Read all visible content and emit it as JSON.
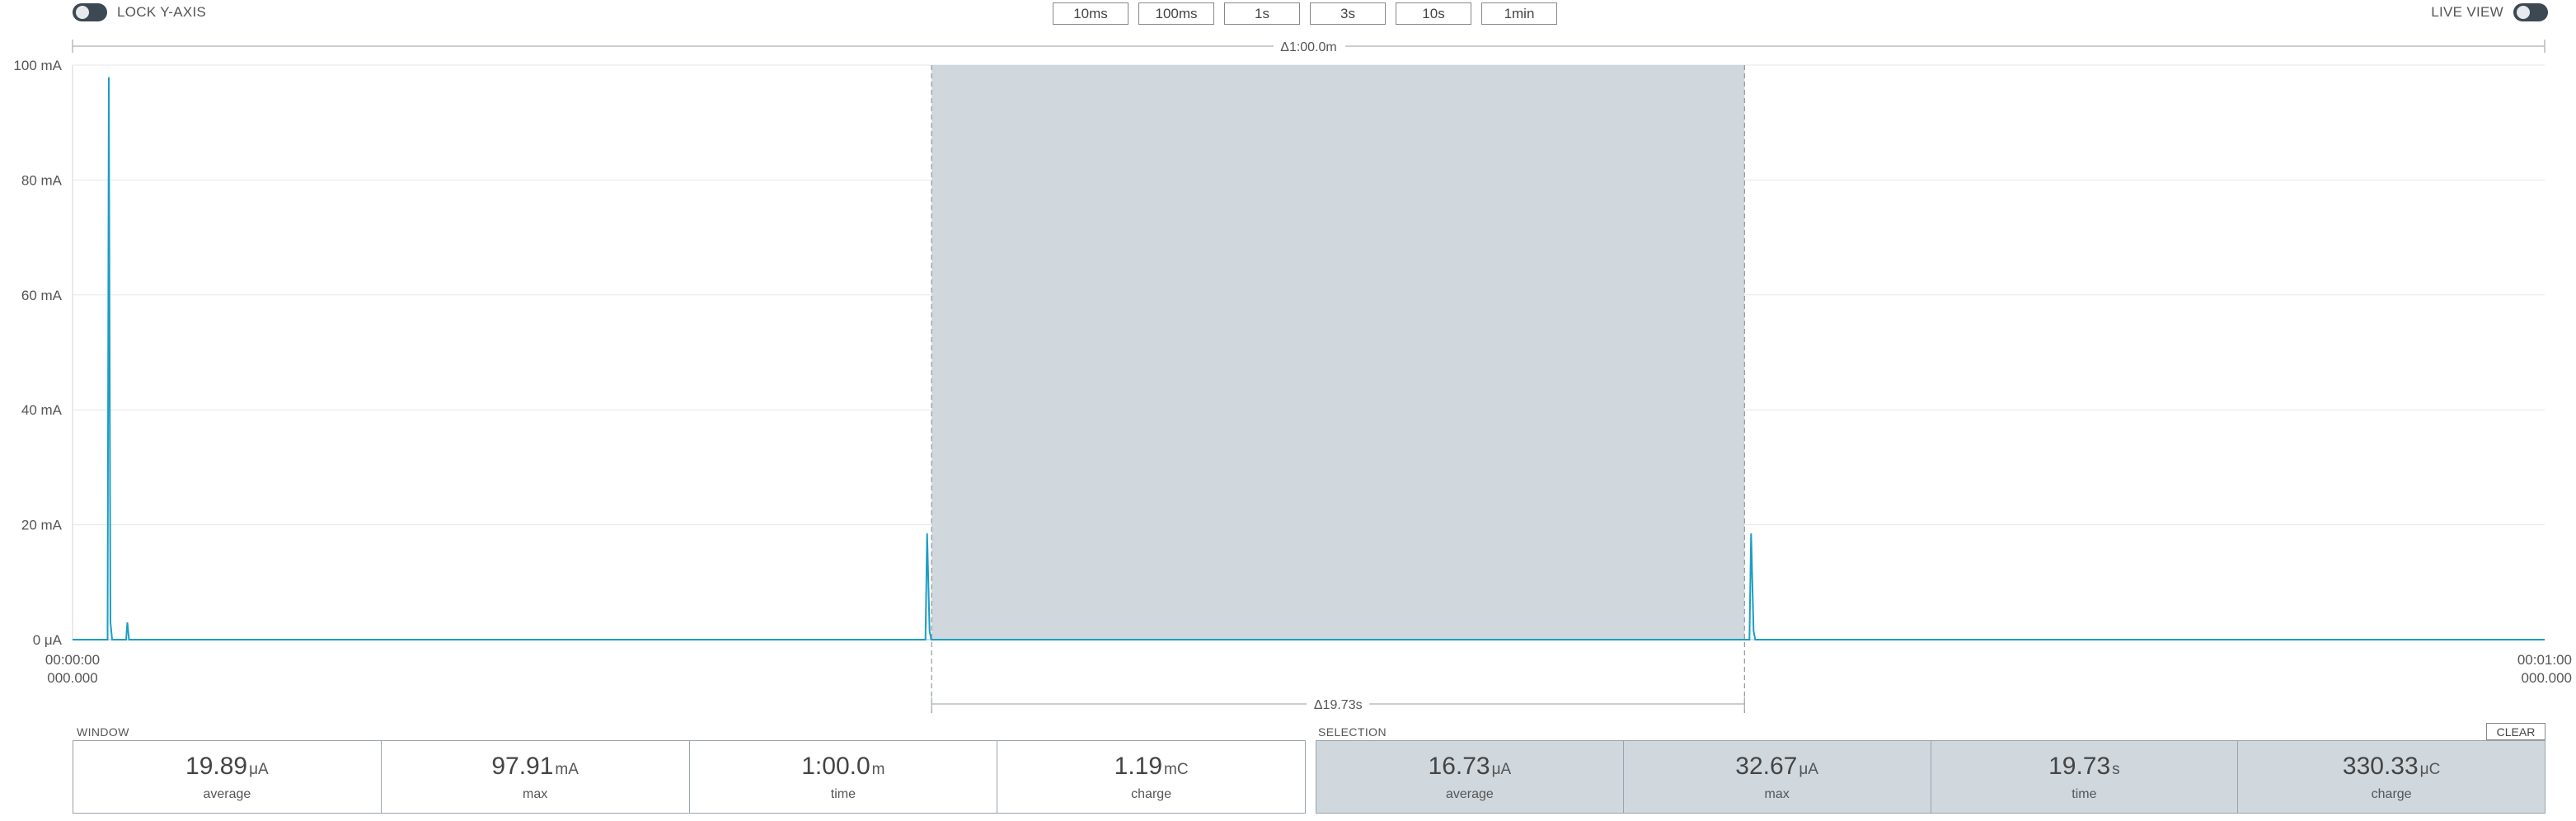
{
  "header": {
    "lock_y_axis_label": "LOCK Y-AXIS",
    "live_view_label": "LIVE VIEW",
    "zoom_buttons": [
      "10ms",
      "100ms",
      "1s",
      "3s",
      "10s",
      "1min"
    ]
  },
  "chart_data": {
    "type": "line",
    "window_duration_label": "Δ1:00.0m",
    "selection_duration_label": "Δ19.73s",
    "y_ticks": [
      "100 mA",
      "80 mA",
      "60 mA",
      "40 mA",
      "20 mA",
      "0 μA"
    ],
    "y_tick_values_mA": [
      100,
      80,
      60,
      40,
      20,
      0
    ],
    "ylim_mA": [
      0,
      100
    ],
    "xlim_s": [
      0,
      60
    ],
    "x_start_label": [
      "00:00:00",
      "000.000"
    ],
    "x_end_label": [
      "00:01:00",
      "000.000"
    ],
    "selection_range_s": [
      20.85,
      40.58
    ],
    "series": [
      {
        "color": "#1b9ec4",
        "x": [
          0,
          0.85,
          0.88,
          0.92,
          0.96,
          1.3,
          1.33,
          1.37,
          1.41,
          20.7,
          20.74,
          20.8,
          20.84,
          40.7,
          40.74,
          40.8,
          40.84,
          60
        ],
        "y": [
          0,
          0,
          97.91,
          3,
          0,
          0,
          3,
          0,
          0,
          0,
          18.5,
          1.5,
          0,
          0,
          18.5,
          1.5,
          0,
          0
        ]
      }
    ]
  },
  "window_stats": {
    "title": "WINDOW",
    "cells": [
      {
        "value": "19.89",
        "unit": "μA",
        "label": "average"
      },
      {
        "value": "97.91",
        "unit": "mA",
        "label": "max"
      },
      {
        "value": "1:00.0",
        "unit": "m",
        "label": "time"
      },
      {
        "value": "1.19",
        "unit": "mC",
        "label": "charge"
      }
    ]
  },
  "selection_stats": {
    "title": "SELECTION",
    "clear_label": "CLEAR",
    "cells": [
      {
        "value": "16.73",
        "unit": "μA",
        "label": "average"
      },
      {
        "value": "32.67",
        "unit": "μA",
        "label": "max"
      },
      {
        "value": "19.73",
        "unit": "s",
        "label": "time"
      },
      {
        "value": "330.33",
        "unit": "μC",
        "label": "charge"
      }
    ]
  }
}
